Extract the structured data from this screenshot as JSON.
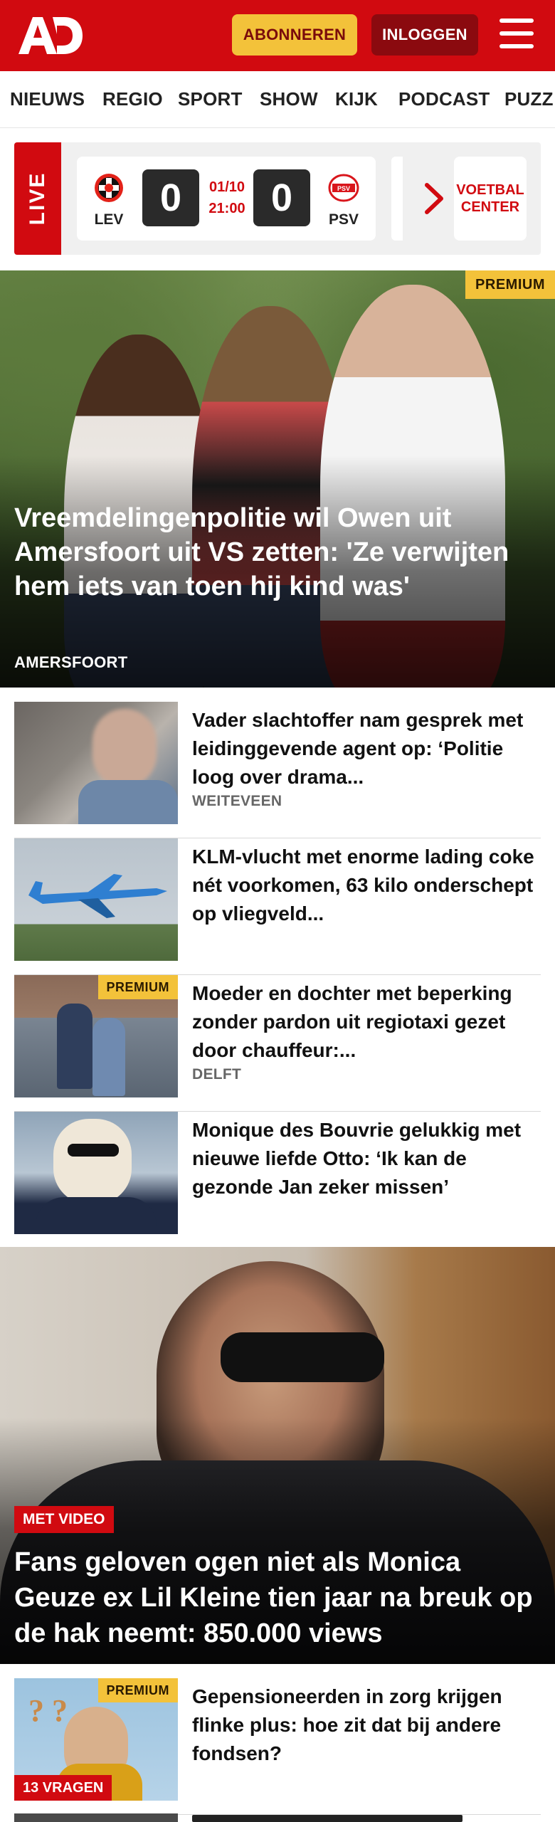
{
  "header": {
    "logo_text": "AD",
    "subscribe_label": "ABONNEREN",
    "login_label": "INLOGGEN",
    "menu_icon": "hamburger-icon",
    "brand_color": "#d10a10"
  },
  "nav": {
    "items": [
      "NIEUWS",
      "REGIO",
      "SPORT",
      "SHOW",
      "KIJK",
      "PODCAST",
      "PUZZ"
    ]
  },
  "live": {
    "label": "LIVE",
    "match": {
      "home": "LEV",
      "away": "PSV",
      "home_score": "0",
      "away_score": "0",
      "date": "01/10",
      "time": "21:00"
    },
    "stub_text": "·",
    "voetbal_center": "VOETBAL CENTER"
  },
  "hero": {
    "badge": "PREMIUM",
    "title": "Vreemdelingenpolitie wil Owen uit Amersfoort uit VS zetten: 'Ze verwijten hem iets van toen hij kind was'",
    "kicker": "AMERSFOORT"
  },
  "articles": [
    {
      "title": "Vader slachtoffer nam gesprek met leidinggevende agent op: ‘Politie loog over drama...",
      "kicker": "WEITEVEEN"
    },
    {
      "title": "KLM-vlucht met enorme lading coke nét voorkomen, 63 kilo onderschept op vliegveld...",
      "kicker": ""
    },
    {
      "badge": "PREMIUM",
      "title": "Moeder en dochter met beperking zonder pardon uit regiotaxi gezet door chauffeur:...",
      "kicker": "DELFT"
    },
    {
      "title": "Monique des Bouvrie gelukkig met nieuwe liefde Otto: ‘Ik kan de gezonde Jan zeker missen’",
      "kicker": ""
    }
  ],
  "video_hero": {
    "tag": "MET VIDEO",
    "title": "Fans geloven ogen niet als Monica Geuze ex Lil Kleine tien jaar na breuk op de hak neemt: 850.000 views"
  },
  "last_article": {
    "badge": "PREMIUM",
    "tag": "13 VRAGEN",
    "title": "Gepensioneerden in zorg krijgen flinke plus: hoe zit dat bij andere fondsen?"
  }
}
